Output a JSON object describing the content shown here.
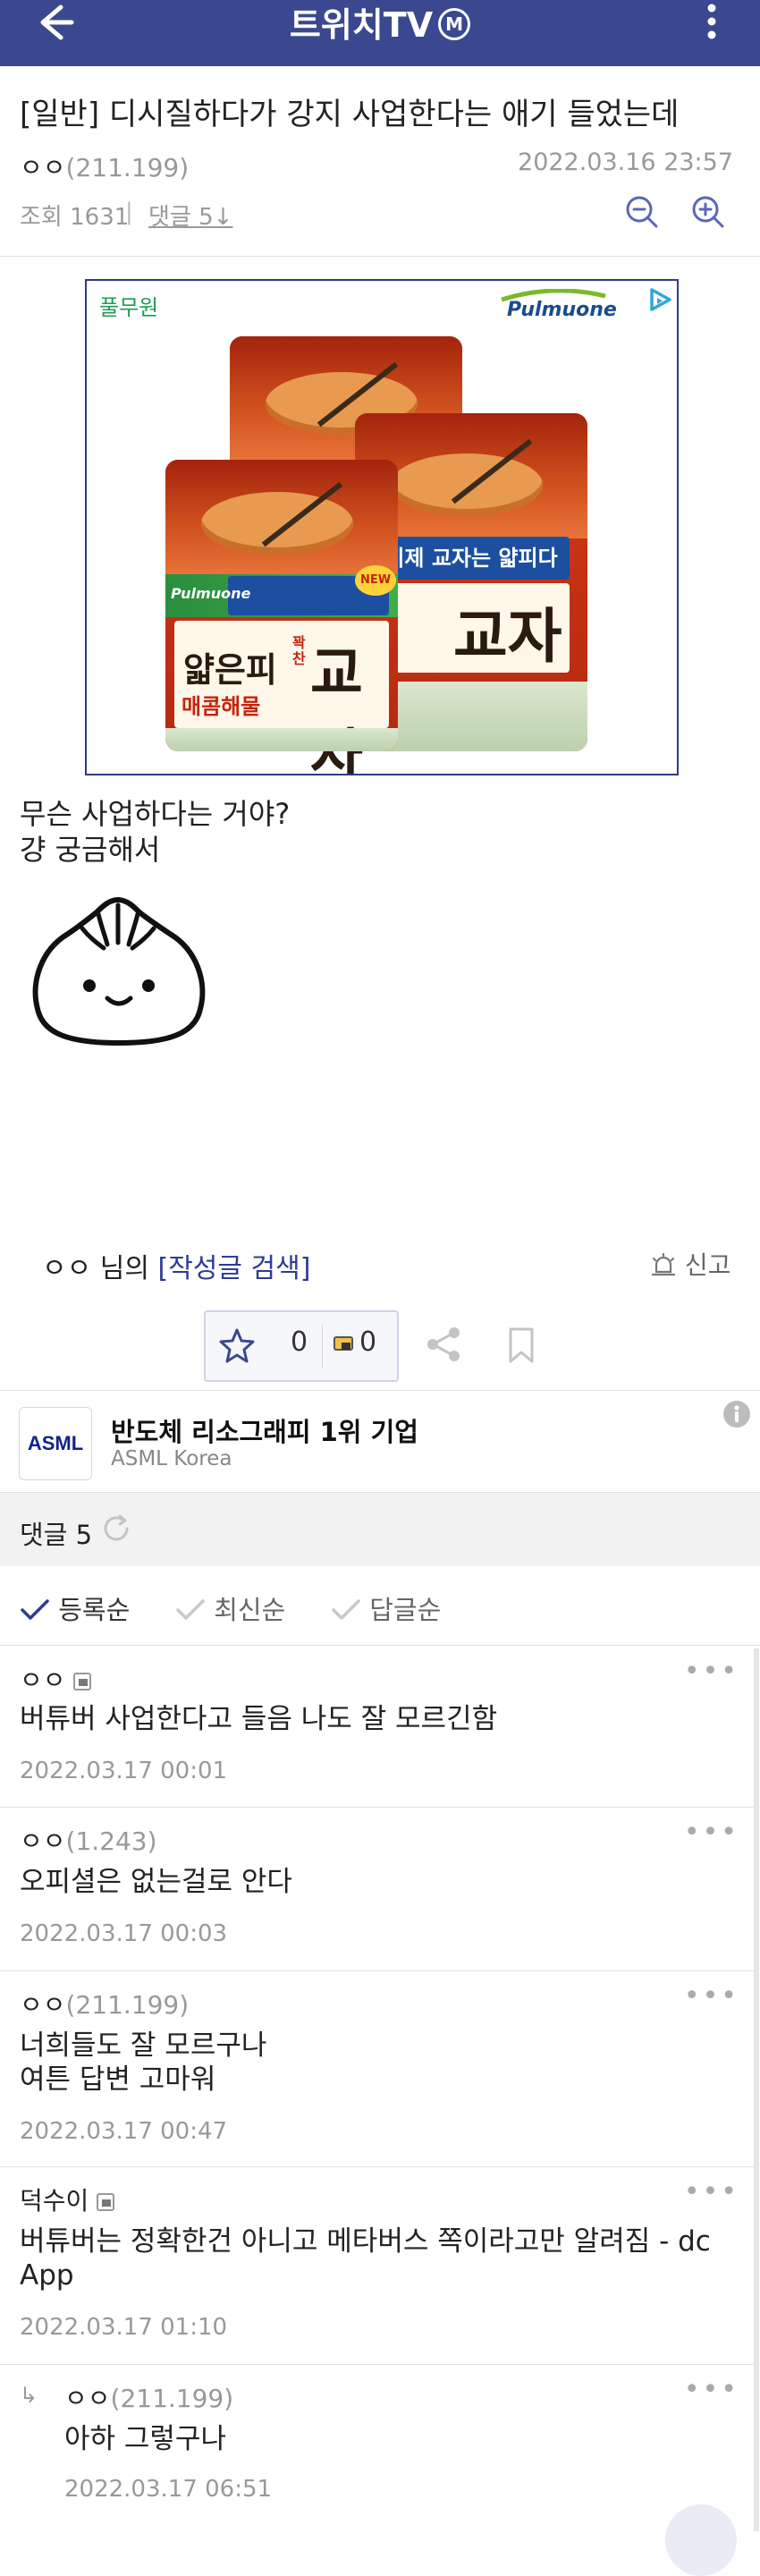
{
  "header": {
    "title": "트위치TV",
    "badge": "M"
  },
  "post": {
    "title": "[일반] 디시질하다가 강지 사업한다는 애기 들었는데",
    "author": "ㅇㅇ",
    "author_ip": "(211.199)",
    "datetime": "2022.03.16 23:57",
    "views_label": "조회 1631",
    "comments_label": "댓글 5",
    "body_lines": [
      "무슨 사업하다는 거야?",
      "걍 궁금해서"
    ],
    "author_suffix": "님의",
    "search_posts_link": "[작성글 검색]",
    "report_label": "신고",
    "recommend_count": "0",
    "fixed_recommend_count": "0"
  },
  "ad_top": {
    "advertiser": "풀무원",
    "brand": "Pulmuone",
    "product_name": "얇은피",
    "product_sub": "꽉찬",
    "product_main": "교자",
    "band_text": "이제 교자는 얇피다",
    "flavor": "매콤해물",
    "new_badge": "NEW"
  },
  "ad_bottom": {
    "logo": "ASML",
    "headline": "반도체 리소그래피 1위 기업",
    "company": "ASML Korea"
  },
  "comments_section": {
    "title": "댓글 5",
    "sort_options": [
      {
        "label": "등록순",
        "active": true
      },
      {
        "label": "최신순",
        "active": false
      },
      {
        "label": "답글순",
        "active": false
      }
    ],
    "items": [
      {
        "name": "ㅇㅇ",
        "ip": "",
        "has_badge": true,
        "text_lines": [
          "버튜버 사업한다고 들음 나도 잘 모르긴함"
        ],
        "date": "2022.03.17 00:01"
      },
      {
        "name": "ㅇㅇ",
        "ip": "(1.243)",
        "has_badge": false,
        "text_lines": [
          "오피셜은 없는걸로 안다"
        ],
        "date": "2022.03.17 00:03"
      },
      {
        "name": "ㅇㅇ",
        "ip": "(211.199)",
        "has_badge": false,
        "text_lines": [
          "너희들도 잘 모르구나",
          "여튼 답변 고마워"
        ],
        "date": "2022.03.17 00:47"
      },
      {
        "name": "덕수이",
        "ip": "",
        "has_badge": true,
        "text_lines": [
          "버튜버는 정확한건 아니고 메타버스 쪽이라고만 알려짐 - dc",
          "App"
        ],
        "date": "2022.03.17 01:10"
      },
      {
        "name": "ㅇㅇ",
        "ip": "(211.199)",
        "has_badge": false,
        "reply": true,
        "text_lines": [
          "아하 그렇구나"
        ],
        "date": "2022.03.17 06:51"
      }
    ]
  },
  "colors": {
    "header_bg": "#3b4890",
    "accent": "#2d3b97",
    "ad_label": "#1f9a58"
  }
}
